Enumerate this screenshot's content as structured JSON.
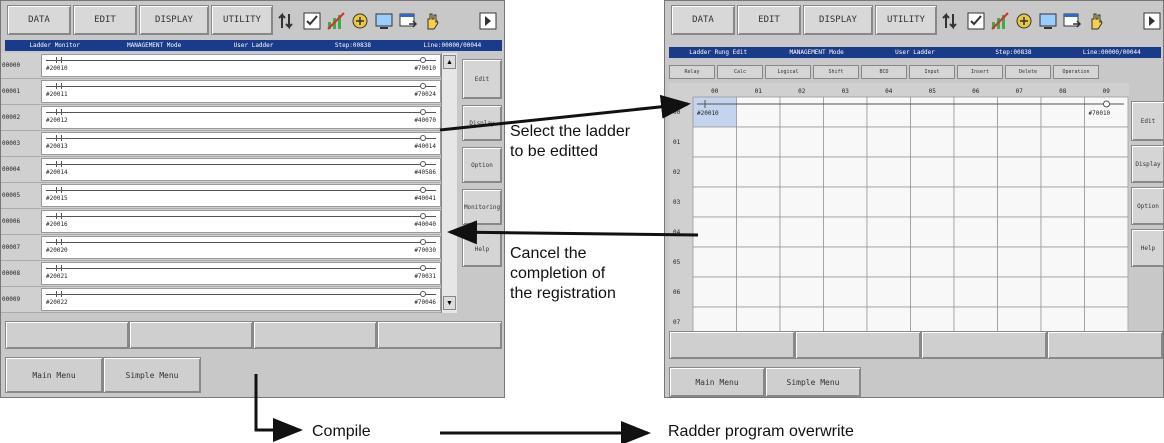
{
  "menu_tabs": [
    "DATA",
    "EDIT",
    "DISPLAY",
    "UTILITY"
  ],
  "left": {
    "status": [
      "Ladder Monitor",
      "MANAGEMENT Mode",
      "User Ladder",
      "Step:00838",
      "Line:00000/00044"
    ],
    "rows": [
      {
        "num": "00000",
        "contact": "#20010",
        "coil": "#70010"
      },
      {
        "num": "00001",
        "contact": "#20011",
        "coil": "#70024"
      },
      {
        "num": "00002",
        "contact": "#20012",
        "coil": "#40070"
      },
      {
        "num": "00003",
        "contact": "#20013",
        "coil": "#40014"
      },
      {
        "num": "00004",
        "contact": "#20014",
        "coil": "#40586"
      },
      {
        "num": "00005",
        "contact": "#20015",
        "coil": "#40041"
      },
      {
        "num": "00006",
        "contact": "#20016",
        "coil": "#40040"
      },
      {
        "num": "00007",
        "contact": "#20020",
        "coil": "#70030"
      },
      {
        "num": "00008",
        "contact": "#20021",
        "coil": "#70031"
      },
      {
        "num": "00009",
        "contact": "#20022",
        "coil": "#70046"
      }
    ],
    "side_buttons": [
      "Edit",
      "Display",
      "Option",
      "Monitoring",
      "Help"
    ],
    "main_menu": "Main Menu",
    "simple_menu": "Simple Menu"
  },
  "right": {
    "status": [
      "Ladder Rung Edit",
      "MANAGEMENT Mode",
      "User Ladder",
      "Step:00838",
      "Line:00000/00044"
    ],
    "edit_buttons": [
      "Relay",
      "Calc",
      "Logical",
      "Shift",
      "BCD",
      "Input",
      "Insert",
      "Delete",
      "Operation"
    ],
    "col_headers": [
      "00",
      "01",
      "02",
      "03",
      "04",
      "05",
      "06",
      "07",
      "08",
      "09"
    ],
    "row_headers": [
      "00",
      "01",
      "02",
      "03",
      "04",
      "05",
      "06",
      "07"
    ],
    "cell_contact": "#20010",
    "cell_coil": "#70010",
    "side_buttons": [
      "Edit",
      "Display",
      "Option",
      "Help"
    ],
    "main_menu": "Main Menu",
    "simple_menu": "Simple Menu"
  },
  "annotations": {
    "select": [
      "Select the ladder",
      "to be editted"
    ],
    "cancel": [
      "Cancel the",
      "completion of",
      "the registration"
    ],
    "compile": "Compile",
    "overwrite": "Radder program overwrite"
  }
}
